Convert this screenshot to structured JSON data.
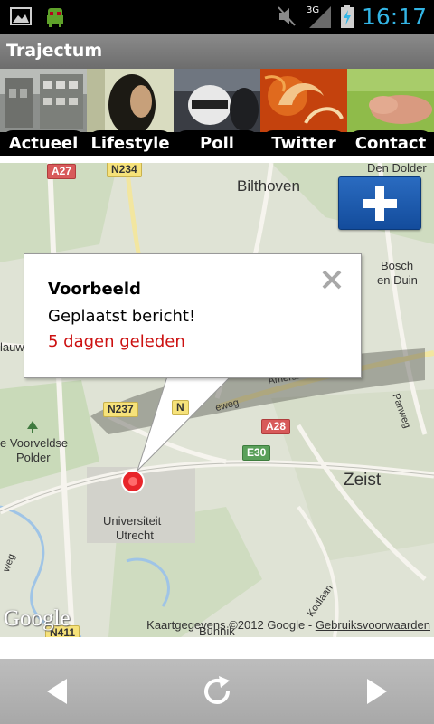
{
  "status_bar": {
    "time": "16:17",
    "network": "3G",
    "icons": [
      "picture-icon",
      "android-icon",
      "mute-icon",
      "signal-icon",
      "battery-charging-icon"
    ]
  },
  "app": {
    "title": "Trajectum"
  },
  "tabs": [
    {
      "label": "Actueel",
      "thumb": "building-photo"
    },
    {
      "label": "Lifestyle",
      "thumb": "portrait-photo"
    },
    {
      "label": "Poll",
      "thumb": "helmet-photo"
    },
    {
      "label": "Twitter",
      "thumb": "ornament-photo"
    },
    {
      "label": "Contact",
      "thumb": "grass-photo"
    }
  ],
  "map": {
    "places": {
      "bilthoven": "Bilthoven",
      "den_dolder": "Den Dolder",
      "bosch": "Bosch",
      "en_duin": "en Duin",
      "zeist": "Zeist",
      "universiteit": "Universiteit",
      "utrecht": "Utrecht",
      "voorveldse": "e Voorveldse",
      "polder": "Polder",
      "lauw": "lauw",
      "amersfoortseweg": "Amersfoortseweg",
      "panweg": "Panweg",
      "eweg": "eweg",
      "weg": "weg",
      "kodlaan": "Kodlaan",
      "bunnik": "Bunnik"
    },
    "roads": {
      "a27": "A27",
      "n234": "N234",
      "n237": "N237",
      "a28": "A28",
      "e30": "E30",
      "n411": "N411",
      "n_partial": "N"
    },
    "add_button_label": "+",
    "info_window": {
      "title": "Voorbeeld",
      "text": "Geplaatst bericht!",
      "time": "5 dagen geleden"
    },
    "logo": "Google",
    "attribution": {
      "text": "Kaartgegevens ©2012 Google - ",
      "link": "Gebruiksvoorwaarden"
    }
  },
  "bottom_bar": {
    "buttons": [
      "back-arrow-icon",
      "refresh-icon",
      "forward-arrow-icon"
    ]
  },
  "colors": {
    "status_bar": "#000000",
    "clock": "#33b5e5",
    "title_bar": "#7b7b7b",
    "marker": "#e8252a",
    "time_text": "#cc1111",
    "add_button": "#1f5eb1",
    "bottom_bar": "#b2b2b2"
  }
}
